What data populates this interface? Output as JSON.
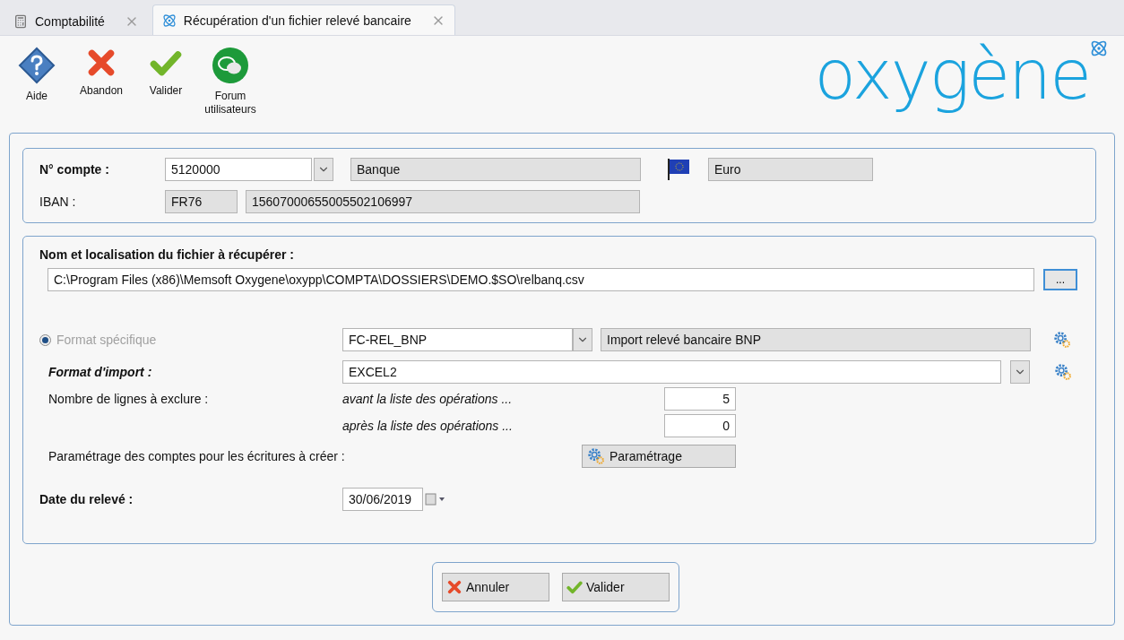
{
  "tabs": [
    {
      "kind": "calculator",
      "label": "Comptabilité",
      "selected": false
    },
    {
      "kind": "atom",
      "label": "Récupération d'un fichier relevé bancaire",
      "selected": true
    }
  ],
  "toolbar": [
    {
      "kind": "help",
      "label": "Aide"
    },
    {
      "kind": "cancel",
      "label": "Abandon"
    },
    {
      "kind": "ok",
      "label": "Valider"
    },
    {
      "kind": "forum",
      "label": "Forum utilisateurs"
    }
  ],
  "logo": {
    "text": "oxygène"
  },
  "account": {
    "label": "N° compte :",
    "number": "5120000",
    "name": "Banque",
    "currency": "Euro",
    "iban_label": "IBAN :",
    "iban_prefix": "FR76",
    "iban_number": "15607000655005502106997"
  },
  "file": {
    "label": "Nom et localisation du fichier à récupérer :",
    "path": "C:\\Program Files (x86)\\Memsoft Oxygene\\oxypp\\COMPTA\\DOSSIERS\\DEMO.$SO\\relbanq.csv",
    "browse": "..."
  },
  "specific_format": {
    "label": "Format spécifique",
    "selected": true,
    "disabled": true,
    "code": "FC-REL_BNP",
    "description": "Import relevé bancaire BNP"
  },
  "import_format": {
    "label": "Format d'import :",
    "value": "EXCEL2"
  },
  "exclude": {
    "label": "Nombre de lignes à exclure :",
    "before_label": "avant la liste des opérations ...",
    "before": "5",
    "after_label": "après la liste des opérations ...",
    "after": "0"
  },
  "accounts_setup": {
    "label": "Paramétrage des comptes pour les écritures à créer :",
    "button": "Paramétrage"
  },
  "date": {
    "label": "Date du relevé :",
    "value": "30/06/2019"
  },
  "buttons": [
    {
      "kind": "cancel",
      "label": "Annuler"
    },
    {
      "kind": "ok",
      "label": "Valider"
    }
  ]
}
